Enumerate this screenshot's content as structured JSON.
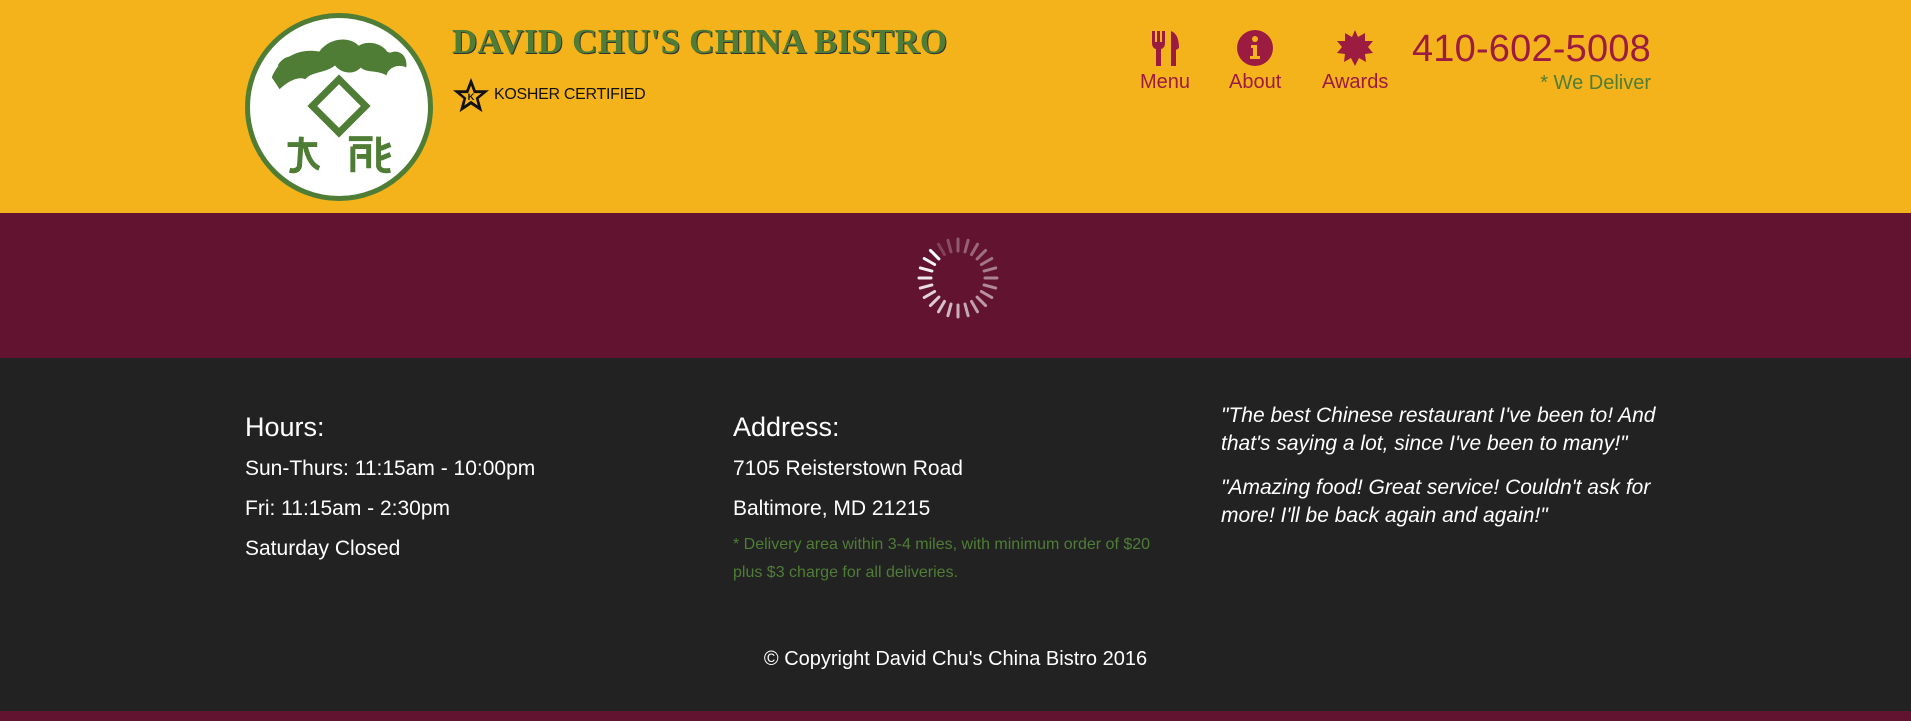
{
  "header": {
    "title": "DAVID CHU'S CHINA BISTRO",
    "kosher_label": "KOSHER CERTIFIED",
    "nav": [
      {
        "label": "Menu",
        "icon": "utensils-icon"
      },
      {
        "label": "About",
        "icon": "info-icon"
      },
      {
        "label": "Awards",
        "icon": "certificate-icon"
      }
    ],
    "phone": "410-602-5008",
    "deliver": "* We Deliver"
  },
  "footer": {
    "hours": {
      "heading": "Hours:",
      "lines": [
        "Sun-Thurs: 11:15am - 10:00pm",
        "Fri: 11:15am - 2:30pm",
        "Saturday Closed"
      ]
    },
    "address": {
      "heading": "Address:",
      "street": "7105 Reisterstown Road",
      "city": "Baltimore, MD 21215",
      "note": "* Delivery area within 3-4 miles, with minimum order of $20 plus $3 charge for all deliveries."
    },
    "quotes": [
      "\"The best Chinese restaurant I've been to! And that's saying a lot, since I've been to many!\"",
      "\"Amazing food! Great service! Couldn't ask for more! I'll be back again and again!\""
    ],
    "copyright": "© Copyright David Chu's China Bistro 2016"
  },
  "colors": {
    "gold": "#f4b31a",
    "maroon": "#61132f",
    "crimson": "#9b1b41",
    "green": "#4f7d36",
    "dark": "#222222"
  }
}
